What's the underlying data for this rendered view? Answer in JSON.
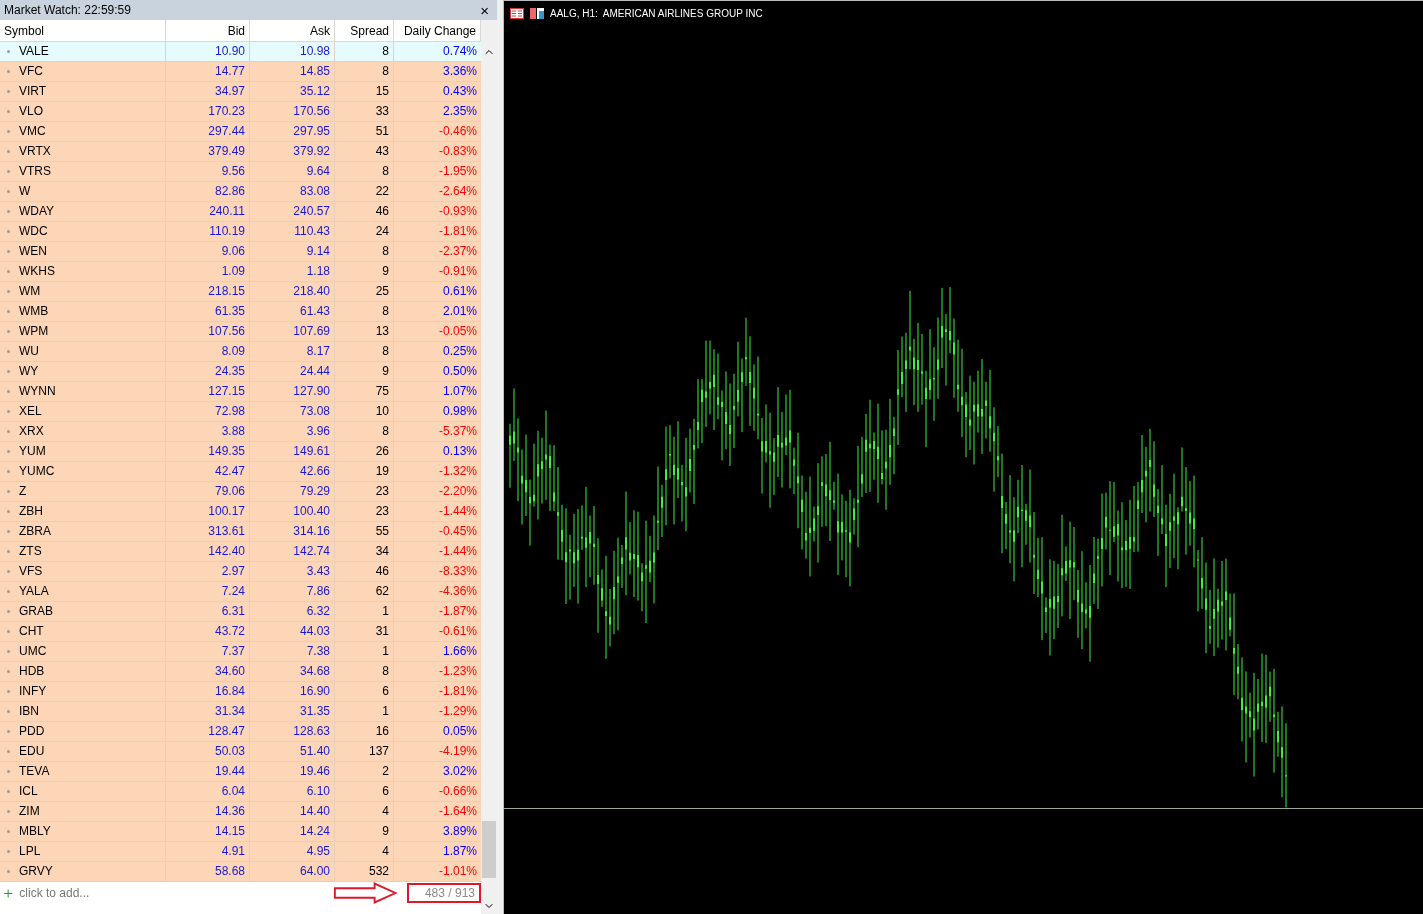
{
  "market_watch": {
    "title": "Market Watch: 22:59:59",
    "close": "×",
    "columns": [
      "Symbol",
      "Bid",
      "Ask",
      "Spread",
      "Daily Change"
    ],
    "rows": [
      {
        "symbol": "VALE",
        "bid": "10.90",
        "ask": "10.98",
        "spread": "8",
        "change": "0.74%",
        "color": "#0000ff",
        "selected": true
      },
      {
        "symbol": "VFC",
        "bid": "14.77",
        "ask": "14.85",
        "spread": "8",
        "change": "3.36%",
        "color": "#0000ff",
        "selected": false
      },
      {
        "symbol": "VIRT",
        "bid": "34.97",
        "ask": "35.12",
        "spread": "15",
        "change": "0.43%",
        "color": "#0000ff",
        "selected": false
      },
      {
        "symbol": "VLO",
        "bid": "170.23",
        "ask": "170.56",
        "spread": "33",
        "change": "2.35%",
        "color": "#0000ff",
        "selected": false
      },
      {
        "symbol": "VMC",
        "bid": "297.44",
        "ask": "297.95",
        "spread": "51",
        "change": "-0.46%",
        "color": "#ff0000",
        "selected": false
      },
      {
        "symbol": "VRTX",
        "bid": "379.49",
        "ask": "379.92",
        "spread": "43",
        "change": "-0.83%",
        "color": "#ff0000",
        "selected": false
      },
      {
        "symbol": "VTRS",
        "bid": "9.56",
        "ask": "9.64",
        "spread": "8",
        "change": "-1.95%",
        "color": "#ff0000",
        "selected": false
      },
      {
        "symbol": "W",
        "bid": "82.86",
        "ask": "83.08",
        "spread": "22",
        "change": "-2.64%",
        "color": "#ff0000",
        "selected": false
      },
      {
        "symbol": "WDAY",
        "bid": "240.11",
        "ask": "240.57",
        "spread": "46",
        "change": "-0.93%",
        "color": "#ff0000",
        "selected": false
      },
      {
        "symbol": "WDC",
        "bid": "110.19",
        "ask": "110.43",
        "spread": "24",
        "change": "-1.81%",
        "color": "#ff0000",
        "selected": false
      },
      {
        "symbol": "WEN",
        "bid": "9.06",
        "ask": "9.14",
        "spread": "8",
        "change": "-2.37%",
        "color": "#ff0000",
        "selected": false
      },
      {
        "symbol": "WKHS",
        "bid": "1.09",
        "ask": "1.18",
        "spread": "9",
        "change": "-0.91%",
        "color": "#ff0000",
        "selected": false
      },
      {
        "symbol": "WM",
        "bid": "218.15",
        "ask": "218.40",
        "spread": "25",
        "change": "0.61%",
        "color": "#0000ff",
        "selected": false
      },
      {
        "symbol": "WMB",
        "bid": "61.35",
        "ask": "61.43",
        "spread": "8",
        "change": "2.01%",
        "color": "#0000ff",
        "selected": false
      },
      {
        "symbol": "WPM",
        "bid": "107.56",
        "ask": "107.69",
        "spread": "13",
        "change": "-0.05%",
        "color": "#ff0000",
        "selected": false
      },
      {
        "symbol": "WU",
        "bid": "8.09",
        "ask": "8.17",
        "spread": "8",
        "change": "0.25%",
        "color": "#0000ff",
        "selected": false
      },
      {
        "symbol": "WY",
        "bid": "24.35",
        "ask": "24.44",
        "spread": "9",
        "change": "0.50%",
        "color": "#0000ff",
        "selected": false
      },
      {
        "symbol": "WYNN",
        "bid": "127.15",
        "ask": "127.90",
        "spread": "75",
        "change": "1.07%",
        "color": "#0000ff",
        "selected": false
      },
      {
        "symbol": "XEL",
        "bid": "72.98",
        "ask": "73.08",
        "spread": "10",
        "change": "0.98%",
        "color": "#0000ff",
        "selected": false
      },
      {
        "symbol": "XRX",
        "bid": "3.88",
        "ask": "3.96",
        "spread": "8",
        "change": "-5.37%",
        "color": "#ff0000",
        "selected": false
      },
      {
        "symbol": "YUM",
        "bid": "149.35",
        "ask": "149.61",
        "spread": "26",
        "change": "0.13%",
        "color": "#0000ff",
        "selected": false
      },
      {
        "symbol": "YUMC",
        "bid": "42.47",
        "ask": "42.66",
        "spread": "19",
        "change": "-1.32%",
        "color": "#ff0000",
        "selected": false
      },
      {
        "symbol": "Z",
        "bid": "79.06",
        "ask": "79.29",
        "spread": "23",
        "change": "-2.20%",
        "color": "#ff0000",
        "selected": false
      },
      {
        "symbol": "ZBH",
        "bid": "100.17",
        "ask": "100.40",
        "spread": "23",
        "change": "-1.44%",
        "color": "#ff0000",
        "selected": false
      },
      {
        "symbol": "ZBRA",
        "bid": "313.61",
        "ask": "314.16",
        "spread": "55",
        "change": "-0.45%",
        "color": "#ff0000",
        "selected": false
      },
      {
        "symbol": "ZTS",
        "bid": "142.40",
        "ask": "142.74",
        "spread": "34",
        "change": "-1.44%",
        "color": "#ff0000",
        "selected": false
      },
      {
        "symbol": "VFS",
        "bid": "2.97",
        "ask": "3.43",
        "spread": "46",
        "change": "-8.33%",
        "color": "#ff0000",
        "selected": false
      },
      {
        "symbol": "YALA",
        "bid": "7.24",
        "ask": "7.86",
        "spread": "62",
        "change": "-4.36%",
        "color": "#ff0000",
        "selected": false
      },
      {
        "symbol": "GRAB",
        "bid": "6.31",
        "ask": "6.32",
        "spread": "1",
        "change": "-1.87%",
        "color": "#ff0000",
        "selected": false
      },
      {
        "symbol": "CHT",
        "bid": "43.72",
        "ask": "44.03",
        "spread": "31",
        "change": "-0.61%",
        "color": "#ff0000",
        "selected": false
      },
      {
        "symbol": "UMC",
        "bid": "7.37",
        "ask": "7.38",
        "spread": "1",
        "change": "1.66%",
        "color": "#0000ff",
        "selected": false
      },
      {
        "symbol": "HDB",
        "bid": "34.60",
        "ask": "34.68",
        "spread": "8",
        "change": "-1.23%",
        "color": "#ff0000",
        "selected": false
      },
      {
        "symbol": "INFY",
        "bid": "16.84",
        "ask": "16.90",
        "spread": "6",
        "change": "-1.81%",
        "color": "#ff0000",
        "selected": false
      },
      {
        "symbol": "IBN",
        "bid": "31.34",
        "ask": "31.35",
        "spread": "1",
        "change": "-1.29%",
        "color": "#ff0000",
        "selected": false
      },
      {
        "symbol": "PDD",
        "bid": "128.47",
        "ask": "128.63",
        "spread": "16",
        "change": "0.05%",
        "color": "#0000ff",
        "selected": false
      },
      {
        "symbol": "EDU",
        "bid": "50.03",
        "ask": "51.40",
        "spread": "137",
        "change": "-4.19%",
        "color": "#ff0000",
        "selected": false
      },
      {
        "symbol": "TEVA",
        "bid": "19.44",
        "ask": "19.46",
        "spread": "2",
        "change": "3.02%",
        "color": "#0000ff",
        "selected": false
      },
      {
        "symbol": "ICL",
        "bid": "6.04",
        "ask": "6.10",
        "spread": "6",
        "change": "-0.66%",
        "color": "#ff0000",
        "selected": false
      },
      {
        "symbol": "ZIM",
        "bid": "14.36",
        "ask": "14.40",
        "spread": "4",
        "change": "-1.64%",
        "color": "#ff0000",
        "selected": false
      },
      {
        "symbol": "MBLY",
        "bid": "14.15",
        "ask": "14.24",
        "spread": "9",
        "change": "3.89%",
        "color": "#0000ff",
        "selected": false
      },
      {
        "symbol": "LPL",
        "bid": "4.91",
        "ask": "4.95",
        "spread": "4",
        "change": "1.87%",
        "color": "#0000ff",
        "selected": false
      },
      {
        "symbol": "GRVY",
        "bid": "58.68",
        "ask": "64.00",
        "spread": "532",
        "change": "-1.01%",
        "color": "#ff0000",
        "selected": false
      }
    ],
    "add_placeholder": "click to add...",
    "count": "483 / 913"
  },
  "chart": {
    "title": "AALG, H1:  AMERICAN AIRLINES GROUP INC"
  }
}
